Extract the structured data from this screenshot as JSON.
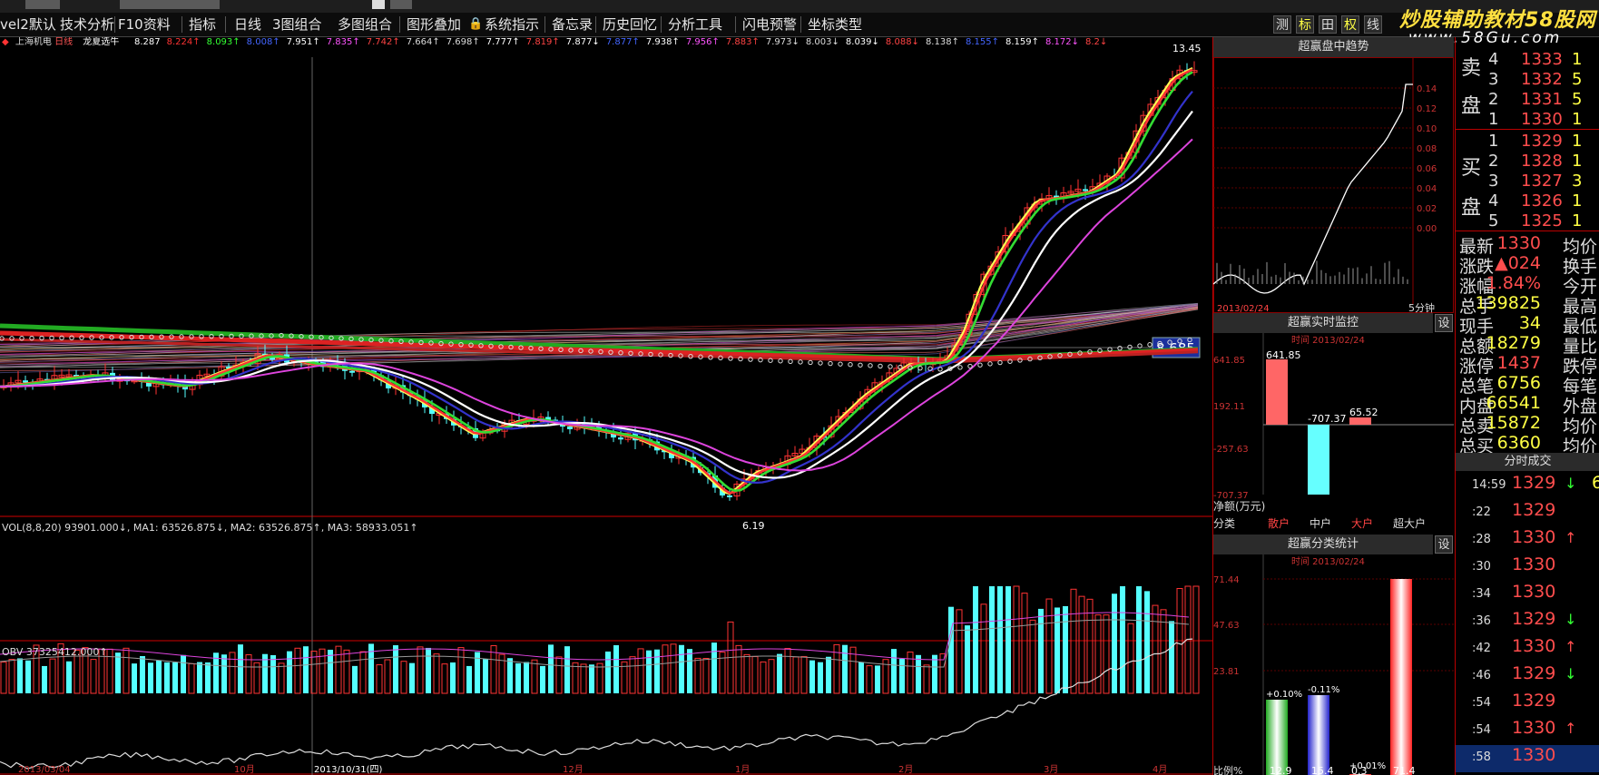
{
  "menubar": {
    "items": [
      "vel2默认",
      "技术分析",
      "F10资料",
      "指标",
      "日线",
      "3图组合",
      "多图组合",
      "图形叠加",
      "系统指示",
      "备忘录",
      "历史回忆",
      "分析工具",
      "闪电预警",
      "坐标类型"
    ],
    "right_buttons": [
      "测",
      "标",
      "田",
      "权",
      "线"
    ]
  },
  "watermark": {
    "line1_a": "炒股辅助教材",
    "line1_b": "58股网",
    "line2": "www.58Gu.com"
  },
  "chart": {
    "stock": "上海机电",
    "period_tag": "日线",
    "formula": "龙夏选牛",
    "ma_values": [
      "8.287",
      "8.224",
      "8.093",
      "8.008",
      "7.951",
      "7.835",
      "7.742",
      "7.664",
      "7.698",
      "7.777",
      "7.819",
      "7.877",
      "7.877",
      "7.938",
      "7.956",
      "7.883",
      "7.973",
      "8.003",
      "8.039",
      "8.088",
      "8.138",
      "8.155",
      "8.159",
      "8.172",
      "8.2"
    ],
    "ma_colors": [
      "#ffffff",
      "#ff3333",
      "#33ff33",
      "#4466ff",
      "#ffffff",
      "#ff55ff",
      "#ff4444",
      "#dddddd",
      "#dddddd",
      "#ffffff",
      "#ff4444",
      "#ffffff",
      "#4466ff",
      "#ffffff",
      "#ff55ff",
      "#ff4444",
      "#dddddd",
      "#dddddd",
      "#ffffff",
      "#ff4444",
      "#dddddd",
      "#4466ff",
      "#ffffff",
      "#ff55ff",
      "#ff4444"
    ],
    "ma_arrows": [
      "",
      "↑",
      "↑",
      "↑",
      "↑",
      "↑",
      "↑",
      "↑",
      "↑",
      "↑",
      "↑",
      "↓",
      "↑",
      "↑",
      "↑",
      "↑",
      "↓",
      "↓",
      "↓",
      "↓",
      "↑",
      "↑",
      "↑",
      "↓",
      "↓"
    ],
    "high_label": "13.45",
    "low_label": "6.19",
    "crosshair_price": "8.685",
    "vol_header": "VOL(8,8,20) 93901.000↓, MA1: 63526.875↓, MA2: 63526.875↑, MA3: 58933.051↑",
    "obv_header": "OBV 37325412.000↑",
    "date_labels": [
      "2013/03/04",
      "10月",
      "2013/10/31(四)",
      "12月",
      "1月",
      "2月",
      "3月",
      "4月"
    ]
  },
  "intraday": {
    "title": "超赢盘中趋势",
    "ticks": [
      "0.14",
      "0.12",
      "0.10",
      "0.08",
      "0.06",
      "0.04",
      "0.02",
      "0.00"
    ],
    "bottom_left": "2013/02/24",
    "bottom_right": "5分钟"
  },
  "monitor": {
    "title": "超赢实时监控",
    "btn": "设",
    "time": "时间  2013/02/24",
    "yticks": [
      "641.85",
      "192.11",
      "-257.63",
      "-707.37"
    ],
    "bars": [
      "641.85",
      "-707.37",
      "65.52",
      ""
    ],
    "unit": "净额(万元)",
    "cats_label": "分类",
    "cats": [
      "散户",
      "中户",
      "大户",
      "超大户"
    ]
  },
  "stats": {
    "title": "超赢分类统计",
    "btn": "设",
    "time": "时间  2013/02/24",
    "yticks": [
      "71.44",
      "47.63",
      "23.81"
    ],
    "bar_labels": [
      "+0.10%",
      "-0.11%",
      "+0.01%"
    ],
    "bottom": [
      "比例%",
      "12.9",
      "15.4",
      "0.3",
      "71.4"
    ]
  },
  "quote": {
    "sell_side": [
      "卖",
      "盘"
    ],
    "buy_side": [
      "买",
      "盘"
    ],
    "sell": [
      {
        "n": "4",
        "p": "1333",
        "v": "1"
      },
      {
        "n": "3",
        "p": "1332",
        "v": "5"
      },
      {
        "n": "2",
        "p": "1331",
        "v": "5"
      },
      {
        "n": "1",
        "p": "1330",
        "v": "1"
      }
    ],
    "buy": [
      {
        "n": "1",
        "p": "1329",
        "v": "1"
      },
      {
        "n": "2",
        "p": "1328",
        "v": "1"
      },
      {
        "n": "3",
        "p": "1327",
        "v": "3"
      },
      {
        "n": "4",
        "p": "1326",
        "v": "1"
      },
      {
        "n": "5",
        "p": "1325",
        "v": "1"
      }
    ],
    "stats": [
      {
        "l": "最新",
        "v": "1330",
        "l2": "均价",
        "c": "#ff4d4d"
      },
      {
        "l": "涨跌",
        "v": "▲024",
        "l2": "换手",
        "c": "#ff4d4d"
      },
      {
        "l": "涨幅",
        "v": "1.84%",
        "l2": "今开",
        "c": "#ff4d4d"
      },
      {
        "l": "总手",
        "v": "139825",
        "l2": "最高",
        "c": "#ffff44"
      },
      {
        "l": "现手",
        "v": "34",
        "l2": "最低",
        "c": "#ffff44"
      },
      {
        "l": "总额",
        "v": "18279",
        "l2": "量比",
        "c": "#ffff44"
      },
      {
        "l": "涨停",
        "v": "1437",
        "l2": "跌停",
        "c": "#ff4d4d"
      },
      {
        "l": "总笔",
        "v": "6756",
        "l2": "每笔",
        "c": "#ffff44"
      },
      {
        "l": "内盘",
        "v": "66541",
        "l2": "外盘",
        "c": "#ffff44"
      },
      {
        "l": "总卖",
        "v": "15872",
        "l2": "均价",
        "c": "#ffff44"
      },
      {
        "l": "总买",
        "v": "6360",
        "l2": "均价",
        "c": "#ffff44"
      }
    ],
    "ticks_title": "分时成交",
    "ticks": [
      {
        "t": "14:59",
        "p": "1329",
        "a": "↓",
        "v": "6"
      },
      {
        "t": ":22",
        "p": "1329",
        "a": "",
        "v": ""
      },
      {
        "t": ":28",
        "p": "1330",
        "a": "↑",
        "v": ""
      },
      {
        "t": ":30",
        "p": "1330",
        "a": "",
        "v": ""
      },
      {
        "t": ":34",
        "p": "1330",
        "a": "",
        "v": ""
      },
      {
        "t": ":36",
        "p": "1329",
        "a": "↓",
        "v": ""
      },
      {
        "t": ":42",
        "p": "1330",
        "a": "↑",
        "v": ""
      },
      {
        "t": ":46",
        "p": "1329",
        "a": "↓",
        "v": ""
      },
      {
        "t": ":54",
        "p": "1329",
        "a": "",
        "v": ""
      },
      {
        "t": ":54",
        "p": "1330",
        "a": "↑",
        "v": ""
      },
      {
        "t": ":58",
        "p": "1330",
        "a": "",
        "v": ""
      }
    ]
  }
}
